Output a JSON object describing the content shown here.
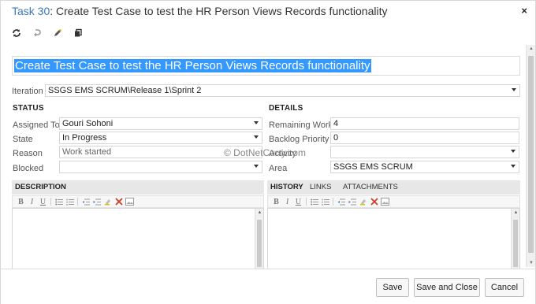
{
  "window": {
    "task_id": "Task 30",
    "title_rest": ": Create Test Case to test the HR Person Views Records functionality",
    "close_glyph": "×"
  },
  "toolbar": {
    "buttons": [
      {
        "name": "refresh-icon"
      },
      {
        "name": "undo-icon"
      },
      {
        "name": "edit-icon"
      },
      {
        "name": "copy-icon"
      }
    ]
  },
  "work_item": {
    "title": "Create Test Case to test the HR Person Views Records functionality"
  },
  "iteration": {
    "label": "Iteration",
    "value": "SSGS EMS SCRUM\\Release 1\\Sprint 2"
  },
  "status": {
    "heading": "STATUS",
    "assigned_to": {
      "label": "Assigned To",
      "value": "Gouri Sohoni"
    },
    "state": {
      "label": "State",
      "value": "In Progress"
    },
    "reason": {
      "label": "Reason",
      "value": "Work started"
    },
    "blocked": {
      "label": "Blocked",
      "value": ""
    }
  },
  "details": {
    "heading": "DETAILS",
    "remaining_work": {
      "label": "Remaining Work",
      "value": "4"
    },
    "backlog_priority": {
      "label": "Backlog Priority",
      "value": "0"
    },
    "activity": {
      "label": "Activity",
      "value": ""
    },
    "area": {
      "label": "Area",
      "value": "SSGS EMS SCRUM"
    }
  },
  "watermark": "© DotNetCurry.com",
  "description_panel": {
    "heading": "DESCRIPTION"
  },
  "history_panel": {
    "tabs": [
      "HISTORY",
      "LINKS",
      "ATTACHMENTS"
    ]
  },
  "rte": {
    "bold": "B",
    "italic": "I",
    "underline": "U"
  },
  "footer": {
    "save": "Save",
    "save_close": "Save and Close",
    "cancel": "Cancel"
  },
  "colors": {
    "task_id": "#3b78b8",
    "title_highlight": "#3399ff"
  }
}
